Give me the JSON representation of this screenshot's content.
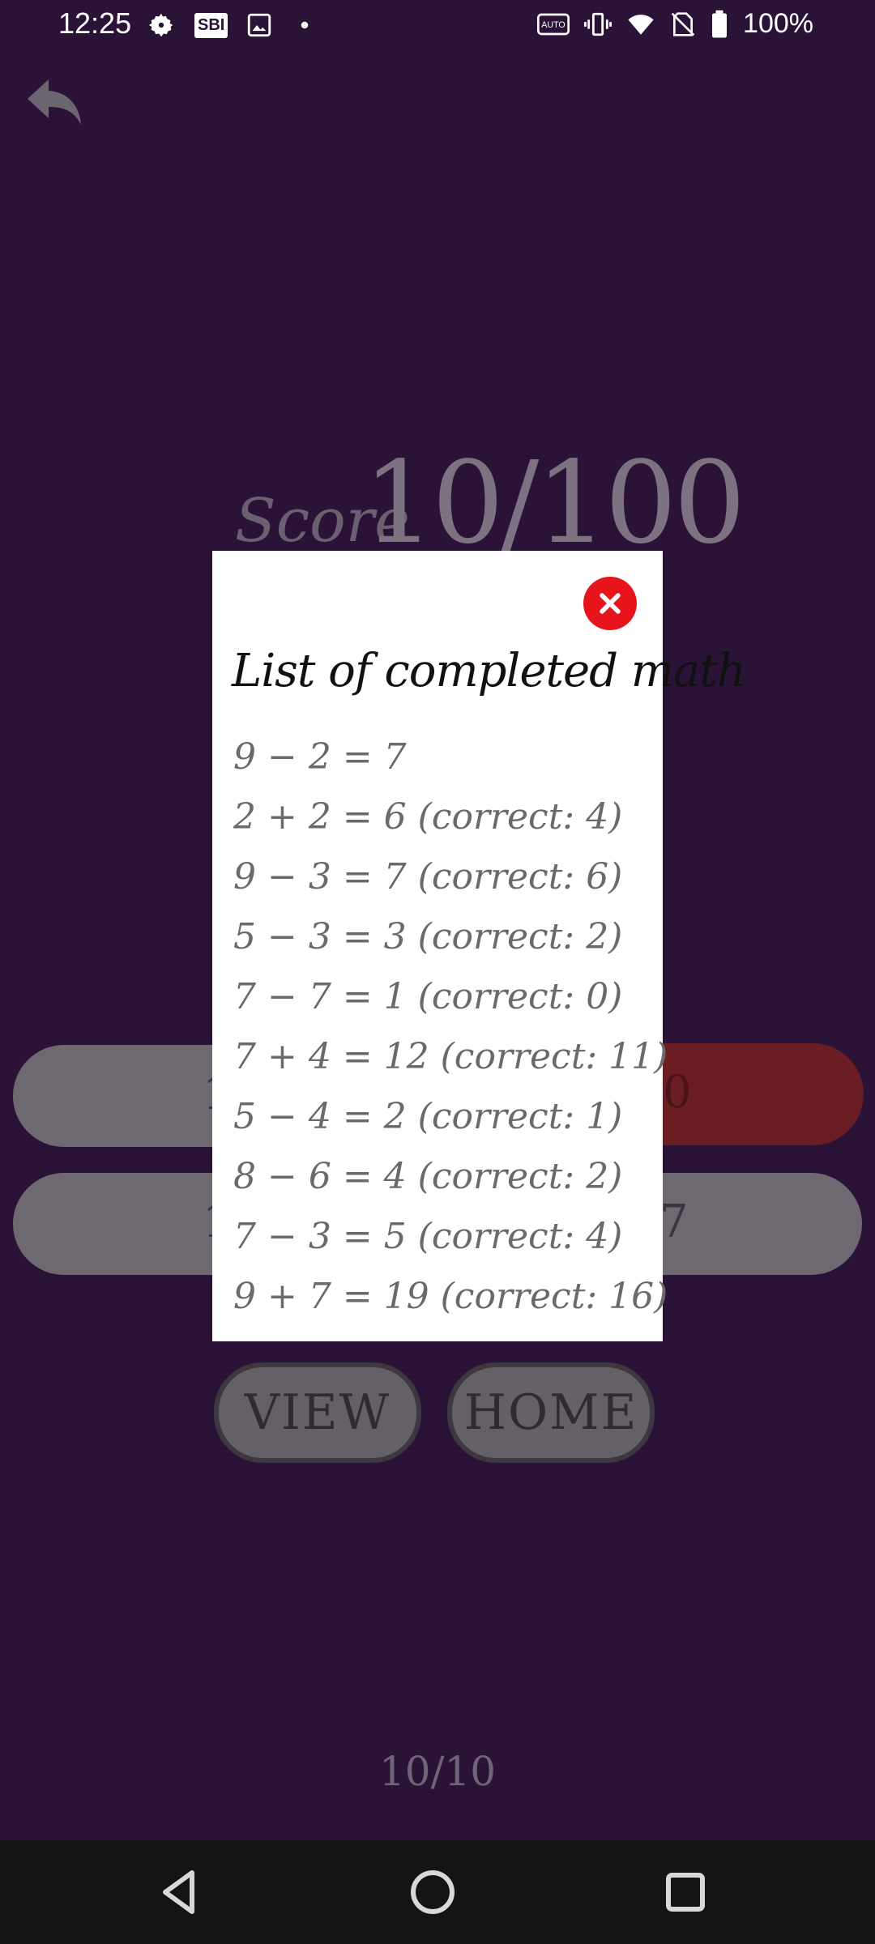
{
  "status_bar": {
    "time": "12:25",
    "sbi_badge": "SBI",
    "battery_text": "100%",
    "icons": [
      "settings-gear-icon",
      "sbi-app-icon",
      "gallery-icon",
      "notification-dot-icon",
      "auto-hz-icon",
      "vibrate-icon",
      "wifi-icon",
      "no-sim-icon",
      "battery-icon"
    ]
  },
  "background_screen": {
    "score_label": "Score",
    "score_value": "10/100",
    "answer_left_1": "1",
    "answer_right_1": "0",
    "answer_left_2": "1",
    "answer_right_2": "7",
    "view_button": "VIEW",
    "home_button": "HOME",
    "progress": "10/10"
  },
  "dialog": {
    "title": "List of completed math",
    "items": [
      "9 − 2 = 7",
      "2 + 2 = 6 (correct: 4)",
      "9 − 3 = 7 (correct: 6)",
      "5 − 3 = 3 (correct: 2)",
      "7 − 7 = 1 (correct: 0)",
      "7 + 4 = 12 (correct: 11)",
      "5 − 4 = 2 (correct: 1)",
      "8 − 6 = 4 (correct: 2)",
      "7 − 3 = 5 (correct: 4)",
      "9 + 7 = 19 (correct: 16)"
    ]
  },
  "colors": {
    "background": "#2b1338",
    "dialog_bg": "#ffffff",
    "close_red": "#e8141c",
    "wrong_answer_red": "#6a1d22"
  }
}
